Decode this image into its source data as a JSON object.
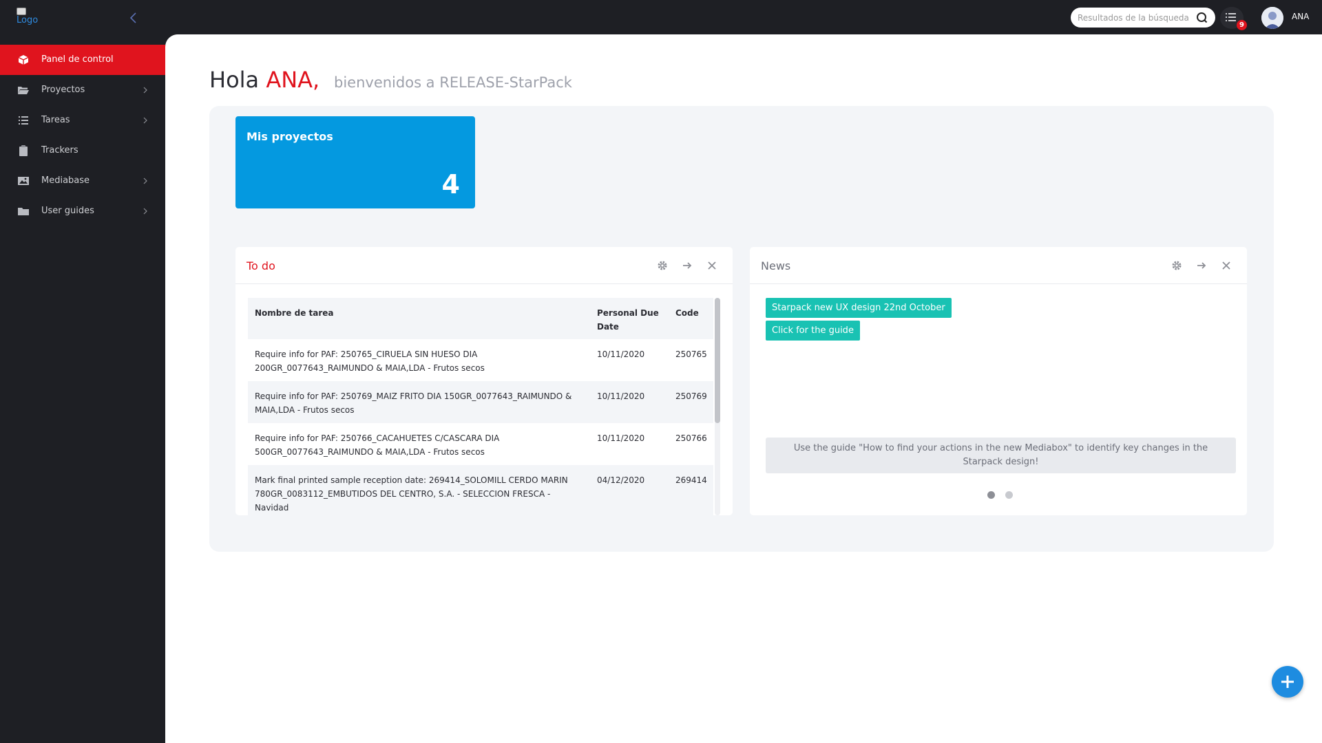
{
  "header": {
    "logo_alt": "Logo",
    "search_placeholder": "Resultados de la búsqueda",
    "notification_count": "9",
    "username": "ANA"
  },
  "sidebar": {
    "items": [
      {
        "label": "Panel de control",
        "icon": "cube-icon",
        "active": true,
        "has_submenu": false
      },
      {
        "label": "Proyectos",
        "icon": "folder-open-icon",
        "has_submenu": true
      },
      {
        "label": "Tareas",
        "icon": "list-icon",
        "has_submenu": true
      },
      {
        "label": "Trackers",
        "icon": "clipboard-icon",
        "has_submenu": false
      },
      {
        "label": "Mediabase",
        "icon": "image-icon",
        "has_submenu": true
      },
      {
        "label": "User guides",
        "icon": "folder-icon",
        "has_submenu": true
      }
    ]
  },
  "main": {
    "greeting": "Hola",
    "user_name": "ANA,",
    "welcome": "bienvenidos a RELEASE-StarPack"
  },
  "projects_card": {
    "title": "Mis proyectos",
    "count": "4"
  },
  "todo": {
    "title": "To do",
    "columns": [
      "Nombre de tarea",
      "Personal Due Date",
      "Code"
    ],
    "rows": [
      {
        "task": "Require info for PAF: 250765_CIRUELA SIN HUESO DIA 200GR_0077643_RAIMUNDO & MAIA,LDA - Frutos secos",
        "due": "10/11/2020",
        "code": "250765"
      },
      {
        "task": "Require info for PAF: 250769_MAIZ FRITO DIA 150GR_0077643_RAIMUNDO & MAIA,LDA - Frutos secos",
        "due": "10/11/2020",
        "code": "250769"
      },
      {
        "task": "Require info for PAF: 250766_CACAHUETES C/CASCARA DIA 500GR_0077643_RAIMUNDO & MAIA,LDA - Frutos secos",
        "due": "10/11/2020",
        "code": "250766"
      },
      {
        "task": "Mark final printed sample reception date: 269414_SOLOMILL CERDO MARIN 780GR_0083112_EMBUTIDOS DEL CENTRO, S.A. - SELECCION FRESCA - Navidad",
        "due": "04/12/2020",
        "code": "269414"
      }
    ]
  },
  "news": {
    "title": "News",
    "tags": [
      "Starpack new UX design 22nd October",
      "Click for the guide"
    ],
    "message": "Use the guide \"How to find your actions in the new Mediabox\" to identify key changes in the Starpack design!",
    "active_slide": 1,
    "slide_count": 2
  },
  "colors": {
    "accent_red": "#e0141e",
    "sidebar_bg": "#1e1f24",
    "card_blue": "#0499e0",
    "news_teal": "#19c2b3",
    "fab_blue": "#1e8ce0"
  }
}
